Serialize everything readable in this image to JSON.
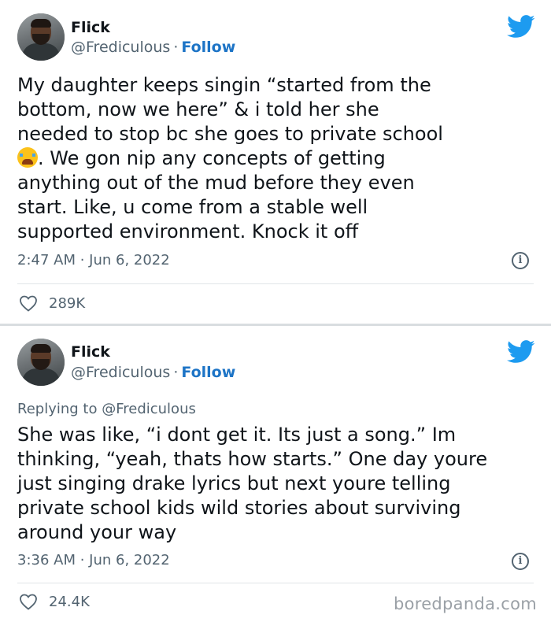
{
  "tweets": [
    {
      "author_name": "Flick",
      "handle": "@Frediculous",
      "separator": "·",
      "follow_label": "Follow",
      "text_lines": [
        "My daughter keeps singin “started from the",
        "bottom, now we here” & i told her she",
        "needed to stop bc she goes to private school",
        ". We gon nip any concepts of getting",
        "anything out of the mud before they even",
        "start. Like, u come from a stable well",
        "supported environment. Knock it off"
      ],
      "emoji": "loudly-crying-face",
      "timestamp": "2:47 AM · Jun 6, 2022",
      "likes": "289K"
    },
    {
      "author_name": "Flick",
      "handle": "@Frediculous",
      "separator": "·",
      "follow_label": "Follow",
      "replying_to": "Replying to @Frediculous",
      "text_lines": [
        "She was like, “i dont get it. Its just a song.” Im",
        "thinking, “yeah, thats how starts.” One day youre",
        "just singing drake lyrics but next youre telling",
        "private school kids wild stories about surviving",
        "around your way"
      ],
      "timestamp": "3:36 AM · Jun 6, 2022",
      "likes": "24.4K"
    }
  ],
  "icons": {
    "brand": "twitter-bird-icon",
    "info": "info-icon",
    "like": "heart-icon",
    "info_glyph": "i"
  },
  "colors": {
    "twitter_blue": "#1d9bf0",
    "follow_link": "#1d74c6",
    "secondary_text": "#536471"
  },
  "watermark": "boredpanda.com"
}
